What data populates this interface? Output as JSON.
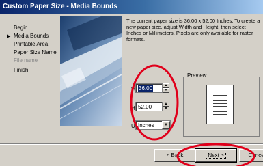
{
  "window": {
    "title": "Custom Paper Size - Media Bounds"
  },
  "steps": [
    {
      "label": "Begin",
      "state": "normal"
    },
    {
      "label": "Media Bounds",
      "state": "active"
    },
    {
      "label": "Printable Area",
      "state": "normal"
    },
    {
      "label": "Paper Size Name",
      "state": "normal"
    },
    {
      "label": "File name",
      "state": "disabled"
    },
    {
      "label": "Finish",
      "state": "normal"
    }
  ],
  "description": "The current paper size is 36.00 x 52.00 Inches. To create a new paper size, adjust Width and Height, then select Inches or Millimeters. Pixels are only available for raster formats.",
  "form": {
    "width_label": "Width",
    "width_value": "36.00",
    "height_label": "Height",
    "height_value": "52.00",
    "units_label": "Units",
    "units_value": "Inches"
  },
  "preview": {
    "label": "Preview"
  },
  "buttons": {
    "back": "< Back",
    "next": "Next >",
    "cancel": "Cancel"
  },
  "colors": {
    "title_bar": "#0a246a",
    "annotation": "#e0001b"
  }
}
